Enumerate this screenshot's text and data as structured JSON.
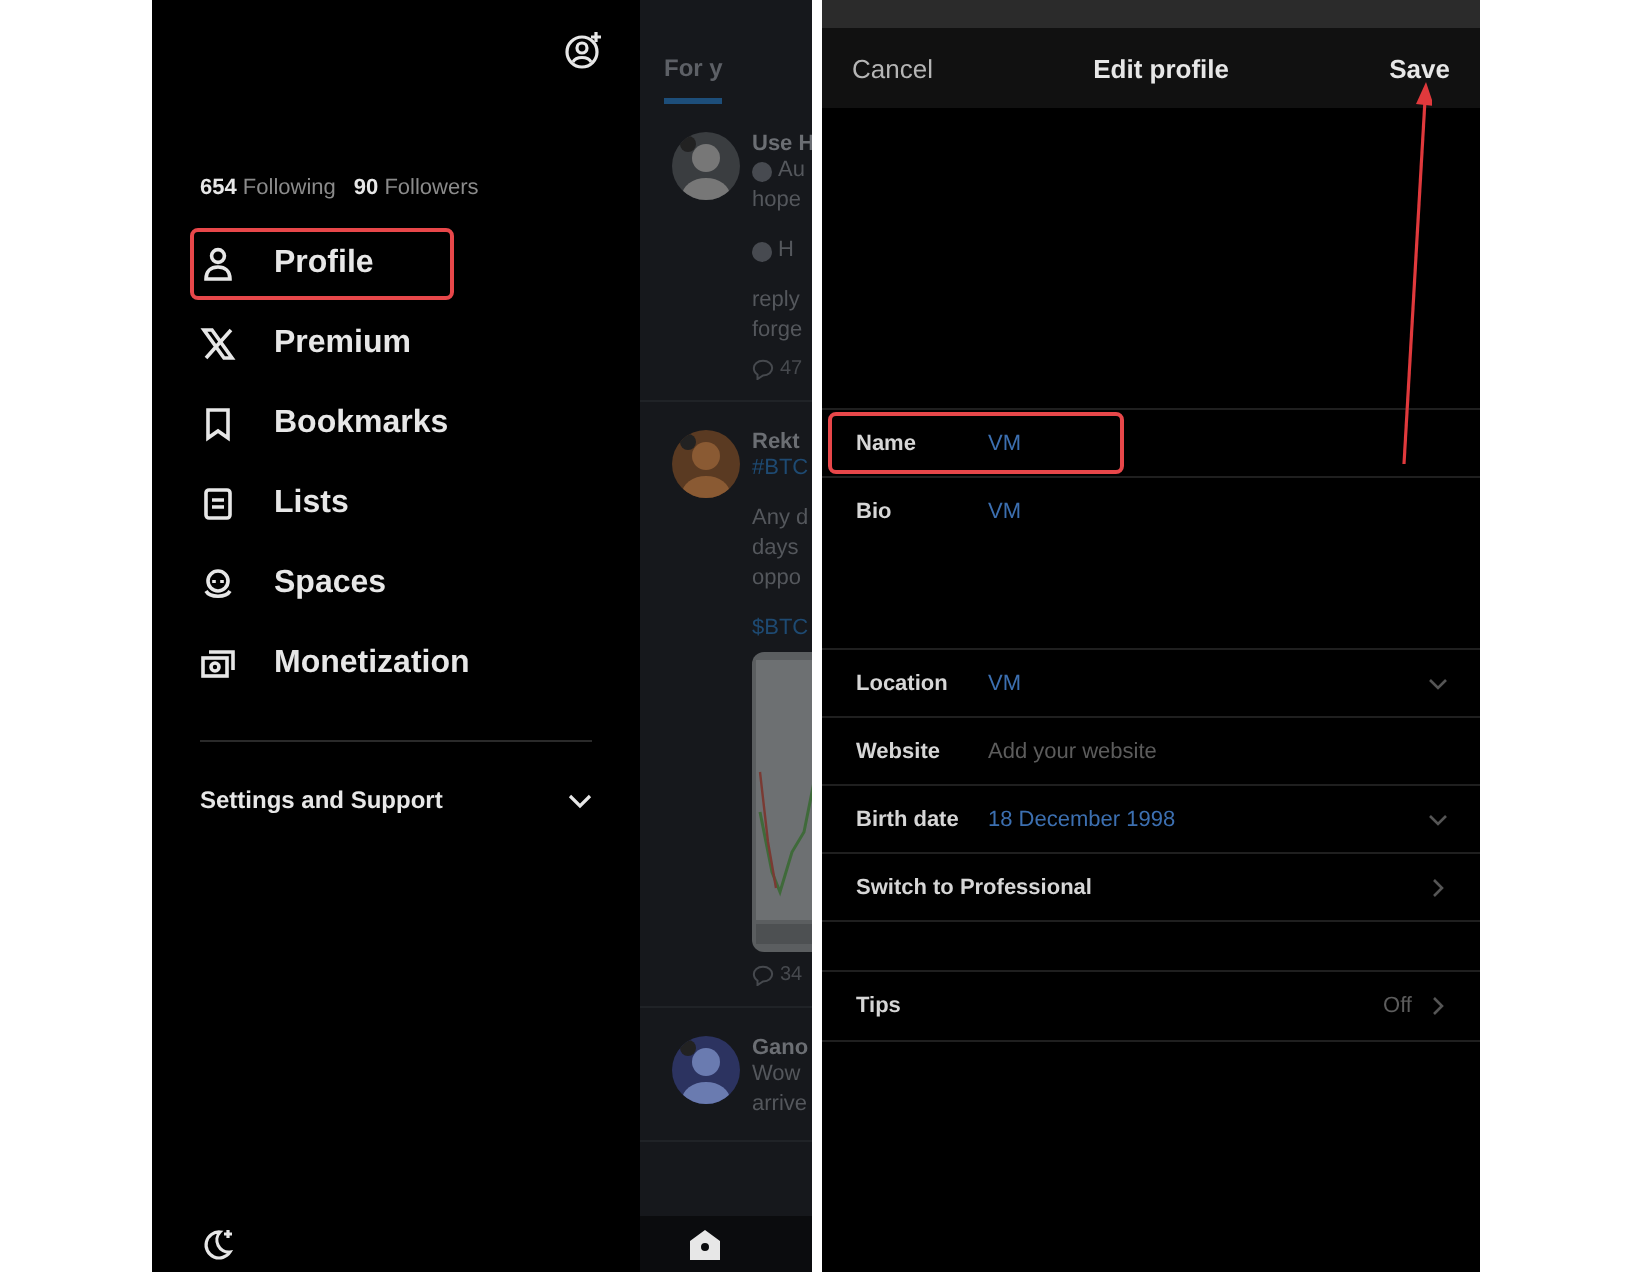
{
  "drawer": {
    "following_count": "654",
    "following_label": "Following",
    "followers_count": "90",
    "followers_label": "Followers",
    "menu": [
      {
        "kind": "profile",
        "label": "Profile",
        "highlighted": true
      },
      {
        "kind": "premium",
        "label": "Premium",
        "highlighted": false
      },
      {
        "kind": "bookmarks",
        "label": "Bookmarks",
        "highlighted": false
      },
      {
        "kind": "lists",
        "label": "Lists",
        "highlighted": false
      },
      {
        "kind": "spaces",
        "label": "Spaces",
        "highlighted": false
      },
      {
        "kind": "monetization",
        "label": "Monetization",
        "highlighted": false
      }
    ],
    "settings": {
      "label": "Settings and Support",
      "expanded": false
    }
  },
  "feed": {
    "tab": "For y",
    "posts": [
      {
        "author": "Use H",
        "lines": [
          {
            "kind": "icon-text",
            "text": "Au"
          },
          {
            "kind": "text",
            "text": "hope"
          },
          {
            "kind": "gap"
          },
          {
            "kind": "icon-text",
            "text": "H"
          },
          {
            "kind": "gap"
          },
          {
            "kind": "text",
            "text": "reply"
          },
          {
            "kind": "text",
            "text": "forge"
          }
        ],
        "comments": "47"
      },
      {
        "author": "Rekt",
        "lines": [
          {
            "kind": "link",
            "text": "#BTC"
          },
          {
            "kind": "gap"
          },
          {
            "kind": "text",
            "text": "Any d"
          },
          {
            "kind": "text",
            "text": "days"
          },
          {
            "kind": "text",
            "text": "oppo"
          },
          {
            "kind": "gap"
          },
          {
            "kind": "link",
            "text": "$BTC"
          },
          {
            "kind": "picture"
          }
        ],
        "comments": "34"
      },
      {
        "author": "Gano",
        "lines": [
          {
            "kind": "text",
            "text": "Wow"
          },
          {
            "kind": "text",
            "text": "arrive"
          }
        ]
      }
    ]
  },
  "edit_profile": {
    "cancel": "Cancel",
    "title": "Edit profile",
    "save": "Save",
    "fields": [
      {
        "kind": "text",
        "label": "Name",
        "value": "VM",
        "highlighted": true
      },
      {
        "kind": "multiline",
        "label": "Bio",
        "value": "VM",
        "highlighted": false
      },
      {
        "kind": "dropdown",
        "label": "Location",
        "value": "VM",
        "highlighted": false
      },
      {
        "kind": "text",
        "label": "Website",
        "placeholder": "Add your website",
        "highlighted": false
      },
      {
        "kind": "dropdown",
        "label": "Birth date",
        "value": "18 December 1998",
        "highlighted": false
      },
      {
        "kind": "link",
        "label": "Switch to Professional",
        "highlighted": false
      }
    ],
    "tips": {
      "label": "Tips",
      "value": "Off"
    }
  }
}
